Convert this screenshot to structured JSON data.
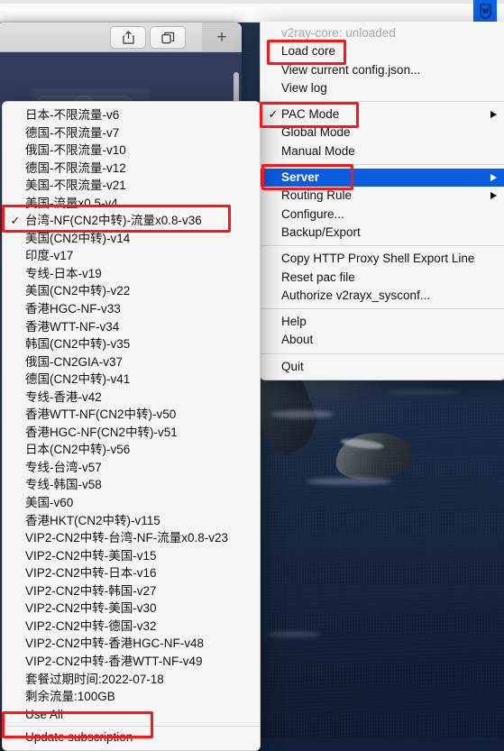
{
  "menubar": {
    "app_icon": "v2rayx-icon",
    "icon_letter": "W"
  },
  "safari": {
    "toolbar": {
      "share_button": "share-icon",
      "tab_overview_button": "tab-overview-icon",
      "new_tab_button": "+"
    }
  },
  "main_menu": {
    "status": "v2ray-core: unloaded",
    "items": [
      {
        "label": "Load core"
      },
      {
        "label": "View current config.json..."
      },
      {
        "label": "View log"
      }
    ],
    "modes": [
      {
        "label": "PAC Mode",
        "checked": "✓",
        "submenu": true
      },
      {
        "label": "Global Mode",
        "checked": "",
        "submenu": false
      },
      {
        "label": "Manual Mode",
        "checked": "",
        "submenu": false
      }
    ],
    "config_items": [
      {
        "label": "Server",
        "submenu": true,
        "selected": true
      },
      {
        "label": "Routing Rule",
        "submenu": true,
        "selected": false
      },
      {
        "label": "Configure...",
        "submenu": false,
        "selected": false
      },
      {
        "label": "Backup/Export",
        "submenu": false,
        "selected": false
      }
    ],
    "tools_items": [
      {
        "label": "Copy HTTP Proxy Shell Export Line"
      },
      {
        "label": "Reset pac file"
      },
      {
        "label": "Authorize v2rayx_sysconf..."
      }
    ],
    "help_items": [
      {
        "label": "Help"
      },
      {
        "label": "About"
      }
    ],
    "quit_item": {
      "label": "Quit"
    }
  },
  "server_menu": {
    "servers": [
      {
        "label": "日本-不限流量-v6",
        "checked": ""
      },
      {
        "label": "德国-不限流量-v7",
        "checked": ""
      },
      {
        "label": "俄国-不限流量-v10",
        "checked": ""
      },
      {
        "label": "德国-不限流量-v12",
        "checked": ""
      },
      {
        "label": "美国-不限流量-v21",
        "checked": ""
      },
      {
        "label": "美国-流量x0.5-v4",
        "checked": ""
      },
      {
        "label": "台湾-NF(CN2中转)-流量x0.8-v36",
        "checked": "✓"
      },
      {
        "label": "美国(CN2中转)-v14",
        "checked": ""
      },
      {
        "label": "印度-v17",
        "checked": ""
      },
      {
        "label": "专线-日本-v19",
        "checked": ""
      },
      {
        "label": "美国(CN2中转)-v22",
        "checked": ""
      },
      {
        "label": "香港HGC-NF-v33",
        "checked": ""
      },
      {
        "label": "香港WTT-NF-v34",
        "checked": ""
      },
      {
        "label": "韩国(CN2中转)-v35",
        "checked": ""
      },
      {
        "label": "俄国-CN2GIA-v37",
        "checked": ""
      },
      {
        "label": "德国(CN2中转)-v41",
        "checked": ""
      },
      {
        "label": "专线-香港-v42",
        "checked": ""
      },
      {
        "label": "香港WTT-NF(CN2中转)-v50",
        "checked": ""
      },
      {
        "label": "香港HGC-NF(CN2中转)-v51",
        "checked": ""
      },
      {
        "label": "日本(CN2中转)-v56",
        "checked": ""
      },
      {
        "label": "专线-台湾-v57",
        "checked": ""
      },
      {
        "label": "专线-韩国-v58",
        "checked": ""
      },
      {
        "label": "美国-v60",
        "checked": ""
      },
      {
        "label": "香港HKT(CN2中转)-v115",
        "checked": ""
      },
      {
        "label": "VIP2-CN2中转-台湾-NF-流量x0.8-v23",
        "checked": ""
      },
      {
        "label": "VIP2-CN2中转-美国-v15",
        "checked": ""
      },
      {
        "label": "VIP2-CN2中转-日本-v16",
        "checked": ""
      },
      {
        "label": "VIP2-CN2中转-韩国-v27",
        "checked": ""
      },
      {
        "label": "VIP2-CN2中转-美国-v30",
        "checked": ""
      },
      {
        "label": "VIP2-CN2中转-德国-v32",
        "checked": ""
      },
      {
        "label": "VIP2-CN2中转-香港HGC-NF-v48",
        "checked": ""
      },
      {
        "label": "VIP2-CN2中转-香港WTT-NF-v49",
        "checked": ""
      },
      {
        "label": "套餐过期时间:2022-07-18",
        "checked": ""
      },
      {
        "label": "剩余流量:100GB",
        "checked": ""
      },
      {
        "label": "Use All",
        "checked": ""
      }
    ],
    "update_item": {
      "label": "Update subscription"
    }
  },
  "colors": {
    "accent_blue": "#0a5ce0",
    "annotation_red": "#ff1515",
    "menu_bg": "#f5f5f5",
    "menubar_icon_bg": "#0a62f0"
  }
}
